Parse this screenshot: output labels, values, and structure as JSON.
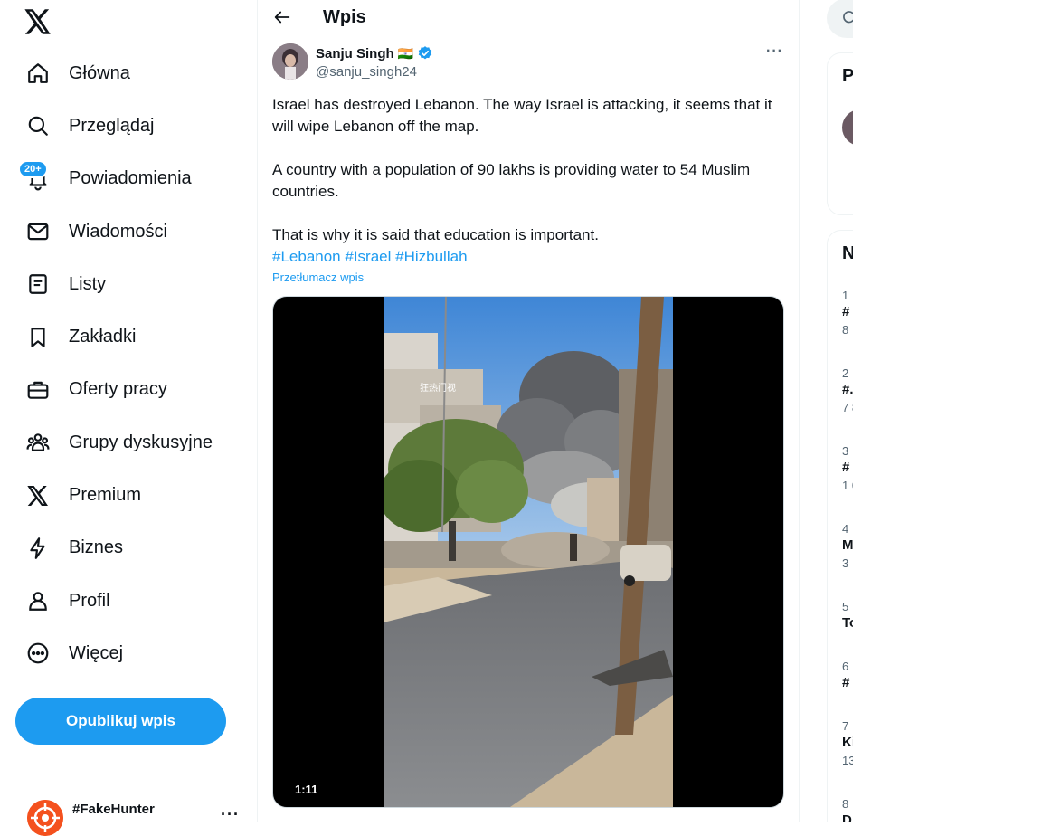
{
  "nav": {
    "items": [
      {
        "label": "Główna",
        "icon": "home-icon"
      },
      {
        "label": "Przeglądaj",
        "icon": "search-icon"
      },
      {
        "label": "Powiadomienia",
        "icon": "bell-icon",
        "badge": "20+"
      },
      {
        "label": "Wiadomości",
        "icon": "mail-icon"
      },
      {
        "label": "Listy",
        "icon": "list-icon"
      },
      {
        "label": "Zakładki",
        "icon": "bookmark-icon"
      },
      {
        "label": "Oferty pracy",
        "icon": "briefcase-icon"
      },
      {
        "label": "Grupy dyskusyjne",
        "icon": "communities-icon"
      },
      {
        "label": "Premium",
        "icon": "x-logo-icon"
      },
      {
        "label": "Biznes",
        "icon": "lightning-icon"
      },
      {
        "label": "Profil",
        "icon": "profile-icon"
      },
      {
        "label": "Więcej",
        "icon": "more-circle-icon"
      }
    ],
    "post_button": "Opublikuj wpis"
  },
  "account": {
    "name": "#FakeHunter",
    "more": "···"
  },
  "header": {
    "title": "Wpis"
  },
  "post": {
    "author_name": "Sanju Singh",
    "flag": "🇮🇳",
    "handle": "@sanju_singh24",
    "more": "···",
    "paragraph1": "Israel has destroyed Lebanon. The way Israel is attacking, it seems that it will wipe Lebanon off the map.",
    "paragraph2": "A country with a population of 90 lakhs is providing water to 54 Muslim countries.",
    "paragraph3": "That is why it is said that education is important.",
    "hashtags": [
      "#Lebanon",
      "#Israel",
      "#Hizbullah"
    ],
    "translate": "Przetłumacz wpis",
    "video": {
      "duration": "1:11",
      "watermark": "狂热门视"
    }
  },
  "right": {
    "card1_title": "P",
    "card2_title": "N",
    "trends": [
      {
        "n": "1 ·",
        "t": "#",
        "c": "8"
      },
      {
        "n": "2",
        "t": "#.",
        "c": "7 8"
      },
      {
        "n": "3",
        "t": "#",
        "c": "1 0"
      },
      {
        "n": "4",
        "t": "M",
        "c": "3"
      },
      {
        "n": "5",
        "t": "To",
        "c": ""
      },
      {
        "n": "6",
        "t": "#",
        "c": ""
      },
      {
        "n": "7",
        "t": "Ki",
        "c": "13"
      },
      {
        "n": "8",
        "t": "D",
        "c": ""
      }
    ]
  },
  "colors": {
    "accent": "#1d9bf0",
    "text": "#0f1419",
    "muted": "#536471",
    "border": "#eff3f4"
  }
}
